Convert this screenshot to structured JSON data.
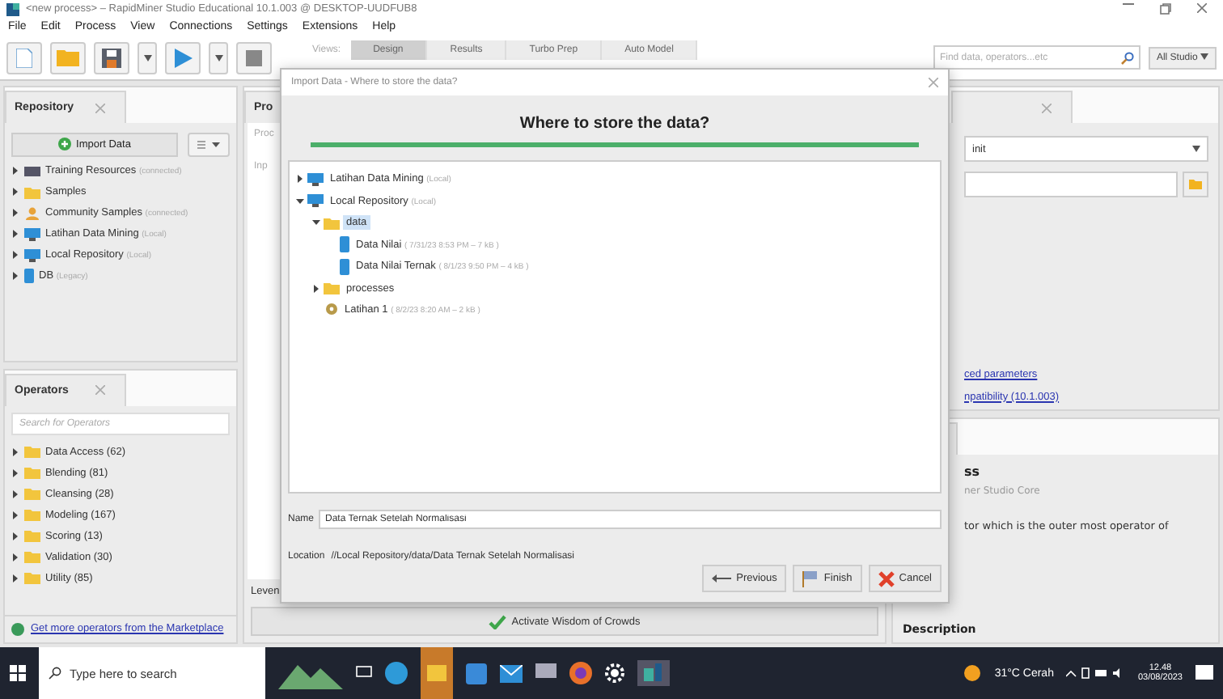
{
  "window": {
    "title": "<new process> – RapidMiner Studio Educational 10.1.003 @ DESKTOP-UUDFUB8"
  },
  "menu": [
    "File",
    "Edit",
    "Process",
    "View",
    "Connections",
    "Settings",
    "Extensions",
    "Help"
  ],
  "views": {
    "label": "Views:",
    "tabs": [
      {
        "label": "Design",
        "selected": true
      },
      {
        "label": "Results",
        "selected": false
      },
      {
        "label": "Turbo Prep",
        "selected": false
      },
      {
        "label": "Auto Model",
        "selected": false
      }
    ]
  },
  "search": {
    "placeholder": "Find data, operators...etc",
    "scope": "All Studio"
  },
  "repository": {
    "tab": "Repository",
    "import_button": "Import Data",
    "items": [
      {
        "name": "Training Resources",
        "note": "(connected)",
        "kind": "server"
      },
      {
        "name": "Samples",
        "kind": "folder"
      },
      {
        "name": "Community Samples",
        "note": "(connected)",
        "kind": "community"
      },
      {
        "name": "Latihan Data Mining",
        "note": "(Local)",
        "kind": "repo"
      },
      {
        "name": "Local Repository",
        "note": "(Local)",
        "kind": "repo"
      },
      {
        "name": "DB",
        "note": "(Legacy)",
        "kind": "db"
      }
    ]
  },
  "operators": {
    "tab": "Operators",
    "placeholder": "Search for Operators",
    "items": [
      "Data Access (62)",
      "Blending (81)",
      "Cleansing (28)",
      "Modeling (167)",
      "Scoring (13)",
      "Validation (30)",
      "Utility (85)"
    ],
    "marketplace_link": "Get more operators from the Marketplace"
  },
  "process": {
    "tab": "Pro",
    "header": "Proc",
    "port": "Inp",
    "footer": "Leven",
    "wisdom_button": "Activate Wisdom of Crowds"
  },
  "parameters": {
    "dropdown": "init",
    "links": [
      "ced parameters",
      "npatibility (10.1.003)"
    ]
  },
  "help": {
    "heading": "ss",
    "subtitle": "ner Studio Core",
    "text": "tor which is the outer most operator of",
    "section": "Description"
  },
  "dialog": {
    "title": "Import Data - Where to store the data?",
    "heading": "Where to store the data?",
    "tree": [
      {
        "name": "Latihan Data Mining",
        "note": "(Local)",
        "kind": "repo",
        "expanded": false,
        "selected": false
      },
      {
        "name": "Local Repository",
        "note": "(Local)",
        "kind": "repo",
        "expanded": true,
        "selected": false,
        "children": [
          {
            "name": "data",
            "kind": "folder",
            "expanded": true,
            "selected": true,
            "children": [
              {
                "name": "Data Nilai",
                "note": "( 7/31/23 8:53 PM – 7 kB )",
                "kind": "data",
                "selected": false
              },
              {
                "name": "Data Nilai Ternak",
                "note": "( 8/1/23 9:50 PM – 4 kB )",
                "kind": "data",
                "selected": false
              }
            ]
          },
          {
            "name": "processes",
            "kind": "folder",
            "expanded": false,
            "selected": false
          },
          {
            "name": "Latihan 1",
            "note": "( 8/2/23 8:20 AM – 2 kB )",
            "kind": "process",
            "selected": false
          }
        ]
      }
    ],
    "name_label": "Name",
    "name_value": "Data Ternak Setelah Normalisasi",
    "location_label": "Location",
    "location_value": "//Local Repository/data/Data Ternak Setelah Normalisasi",
    "buttons": [
      {
        "label": "Previous",
        "kind": "previous"
      },
      {
        "label": "Finish",
        "kind": "finish"
      },
      {
        "label": "Cancel",
        "kind": "cancel"
      }
    ]
  },
  "taskbar": {
    "search_placeholder": "Type here to search",
    "weather": "31°C  Cerah",
    "time": "12.48",
    "date": "03/08/2023"
  }
}
